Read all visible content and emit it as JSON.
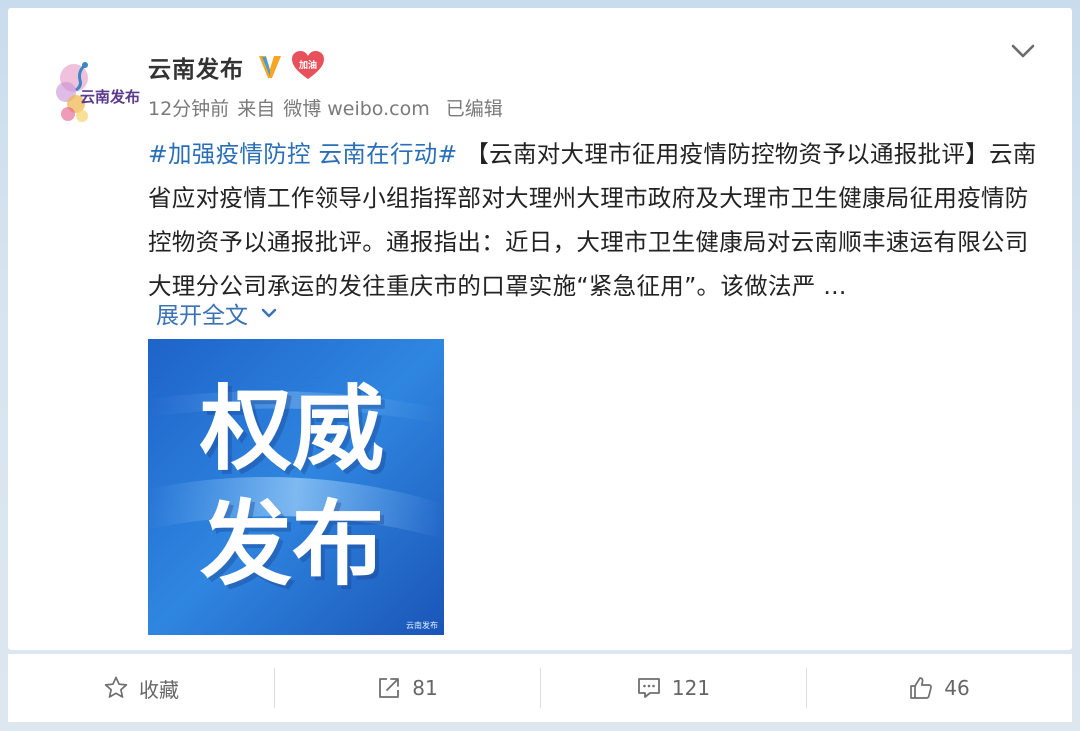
{
  "user": {
    "name": "云南发布",
    "avatar_text": "云南发布",
    "badge_text": "加油"
  },
  "meta": {
    "time": "12分钟前",
    "source_prefix": "来自",
    "source": "微博 weibo.com",
    "edited": "已编辑"
  },
  "post": {
    "hashtag": "#加强疫情防控 云南在行动#",
    "text": "【云南对大理市征用疫情防控物资予以通报批评】云南省应对疫情工作领导小组指挥部对大理州大理市政府及大理市卫生健康局征用疫情防控物资予以通报批评。通报指出：近日，大理市卫生健康局对云南顺丰速运有限公司大理分公司承运的发往重庆市的口罩实施“紧急征用”。该做法严 ...",
    "expand_label": "展开全文"
  },
  "image": {
    "line1": "权威",
    "line2": "发布",
    "watermark": "云南发布"
  },
  "actions": {
    "favorite_label": "收藏",
    "repost_count": "81",
    "comment_count": "121",
    "like_count": "46"
  },
  "colors": {
    "link": "#2a6eb8",
    "verified": "#f6a623",
    "badge": "#e8505b",
    "background": "#d7e4ef"
  },
  "icons": [
    "peacock-logo",
    "verified-v-icon",
    "heart-badge-icon",
    "chevron-down-icon",
    "star-icon",
    "repost-icon",
    "comment-icon",
    "thumb-up-icon"
  ]
}
